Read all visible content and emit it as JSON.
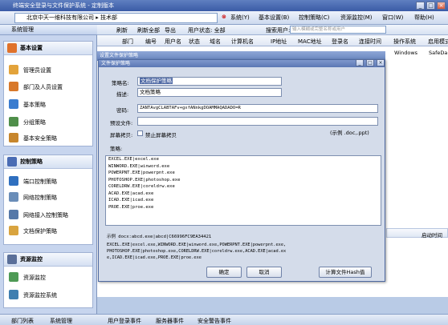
{
  "window": {
    "title": "终端安全登录与文件保护系统 - 定制版本"
  },
  "topbar": {
    "address": "北京中天一维科技有限公司 ▸ 技术部",
    "menus": [
      "系统(Y)",
      "基本设置(B)",
      "控制策略(C)",
      "资源监控(M)",
      "窗口(W)",
      "帮助(H)"
    ]
  },
  "sidebar": {
    "title": "系统管理",
    "sections": [
      {
        "title": "基本设置",
        "items": [
          "管理员设置",
          "部门及人员设置",
          "基本策略",
          "分组策略",
          "基本安全策略"
        ]
      },
      {
        "title": "控制策略",
        "items": [
          "端口控制策略",
          "网络控制策略",
          "网络接入控制策略",
          "文档保护策略"
        ]
      },
      {
        "title": "资源监控",
        "items": [
          "资源监控",
          "资源监控系统"
        ]
      }
    ]
  },
  "toolbar": {
    "items": [
      "刷新",
      "刷新全部",
      "导出",
      "用户状态: 全部",
      "搜索用户:"
    ],
    "search_placeholder": "输入模糊或完整名称或用户"
  },
  "grid": {
    "columns": [
      "部门",
      "编号",
      "用户名",
      "状态",
      "域名",
      "计算机名",
      "IP地址",
      "MAC地址",
      "登录名",
      "连接时间",
      "操作系统",
      "启用模式"
    ],
    "row": {
      "os": "Windows",
      "mode": "SafeDa"
    },
    "right_header": "启动时间"
  },
  "status": {
    "tabs": [
      "部门列表",
      "系统管理",
      "用户登录事件",
      "服务器事件",
      "安全警告事件"
    ]
  },
  "outer_dialog": {
    "title": "设置文件保护策略"
  },
  "dialog": {
    "title": "文件保护策略",
    "strategy_name_label": "策略名:",
    "strategy_name": "文档保护策略",
    "description_label": "描述:",
    "description": "文档策略",
    "password_label": "密码:",
    "password": "ZANTAvgCLABTAFv+gxfANnkgDOAMMAQADADO=R",
    "preset_file_label": "预设文件:",
    "screen_label": "屏幕拷贝:",
    "screen_checkbox": "禁止屏幕拷贝",
    "example_ext": "(示例 .doc,.ppt)",
    "policy_label": "策略:",
    "policy_lines": [
      "EXCEL.EXE|excel.exe",
      "WINWORD.EXE|winword.exe",
      "POWERPNT.EXE|powerpnt.exe",
      "PHOTOSHOP.EXE|photoshop.exe",
      "CORELDRW.EXE|coreldrw.exe",
      "ACAD.EXE|acad.exe",
      "ICAD.EXE|icad.exe",
      "PROE.EXE|proe.exe"
    ],
    "example_line": "示例 docx:abcd.exe|abcd|C66996FC9EA34421",
    "sample_text": "EXCEL.EXE|excel.exe,WINWORD.EXE|winword.exe,POWERPNT.EXE|powerpnt.exe,PHOTOSHOP.EXE|photoshop.exe,CORELDRW.EXE|coreldrw.exe,ACAD.EXE|acad.exe,ICAD.EXE|icad.exe,PROE.EXE|proe.exe",
    "buttons": {
      "ok": "确定",
      "cancel": "取消",
      "hash": "计算文件Hash值"
    }
  }
}
